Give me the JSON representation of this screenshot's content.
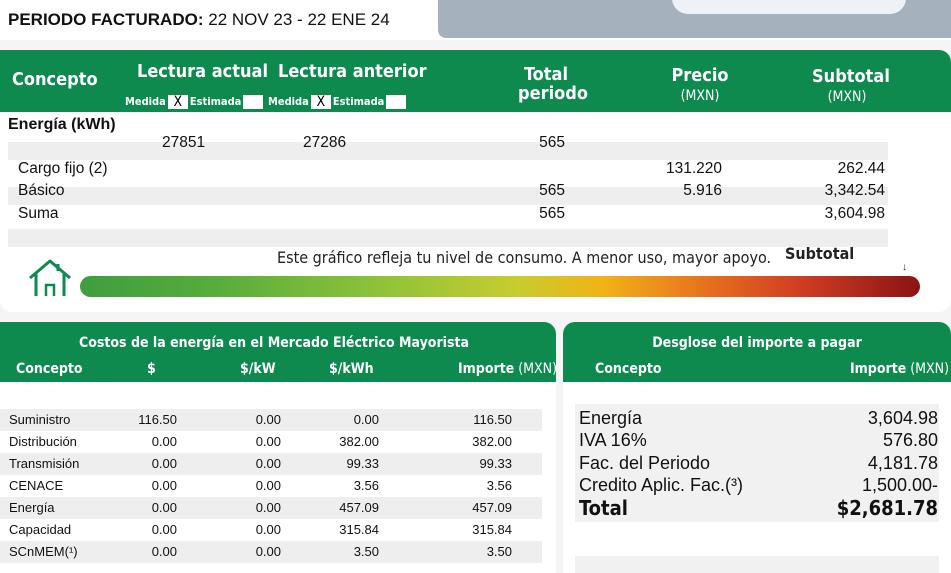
{
  "period": {
    "label": "PERIODO FACTURADO:",
    "value": "22 NOV 23 - 22 ENE 24"
  },
  "consumption": {
    "headers": {
      "concept": "Concepto",
      "current": "Lectura actual",
      "previous": "Lectura anterior",
      "total_line1": "Total",
      "total_line2": "periodo",
      "price_line1": "Precio",
      "price_line2": "(MXN)",
      "subtotal_line1": "Subtotal",
      "subtotal_line2": "(MXN)",
      "measured": "Medida",
      "estimated": "Estimada",
      "mark": "X"
    },
    "section_title": "Energía (kWh)",
    "reading_row": {
      "current": "27851",
      "previous": "27286",
      "total": "565"
    },
    "rows": [
      {
        "concept": "Cargo fijo (2)",
        "total": "",
        "price": "131.220",
        "subtotal": "262.44"
      },
      {
        "concept": "Básico",
        "total": "565",
        "price": "5.916",
        "subtotal": "3,342.54"
      },
      {
        "concept": "Suma",
        "total": "565",
        "price": "",
        "subtotal": "3,604.98"
      }
    ],
    "gauge_caption": "Este gráfico refleja tu nivel de consumo. A menor uso, mayor apoyo.",
    "gauge_label": "Subtotal",
    "gauge_marker": "↓",
    "home_icon": "house-icon"
  },
  "market_costs": {
    "title": "Costos de la energía en el Mercado Eléctrico Mayorista",
    "columns": [
      "Concepto",
      "$",
      "$/kW",
      "$/kWh",
      "Importe",
      "(MXN)"
    ],
    "rows": [
      [
        "Suministro",
        "116.50",
        "0.00",
        "0.00",
        "116.50"
      ],
      [
        "Distribución",
        "0.00",
        "0.00",
        "382.00",
        "382.00"
      ],
      [
        "Transmisión",
        "0.00",
        "0.00",
        "99.33",
        "99.33"
      ],
      [
        "CENACE",
        "0.00",
        "0.00",
        "3.56",
        "3.56"
      ],
      [
        "Energía",
        "0.00",
        "0.00",
        "457.09",
        "457.09"
      ],
      [
        "Capacidad",
        "0.00",
        "0.00",
        "315.84",
        "315.84"
      ],
      [
        "SCnMEM(¹)",
        "0.00",
        "0.00",
        "3.50",
        "3.50"
      ]
    ]
  },
  "payment_breakdown": {
    "title": "Desglose del importe a pagar",
    "col_concept": "Concepto",
    "col_amount": "Importe",
    "col_unit": "(MXN)",
    "rows": [
      {
        "concept": "Energía",
        "amount": "3,604.98"
      },
      {
        "concept": "IVA 16%",
        "amount": "576.80"
      },
      {
        "concept": "Fac. del Periodo",
        "amount": "4,181.78"
      },
      {
        "concept": "Credito Aplic. Fac.(³)",
        "amount": "1,500.00-"
      }
    ],
    "total": {
      "concept": "Total",
      "amount": "$2,681.78"
    }
  },
  "colors": {
    "green": "#0e8a4f",
    "stripe": "#eeeeee"
  }
}
